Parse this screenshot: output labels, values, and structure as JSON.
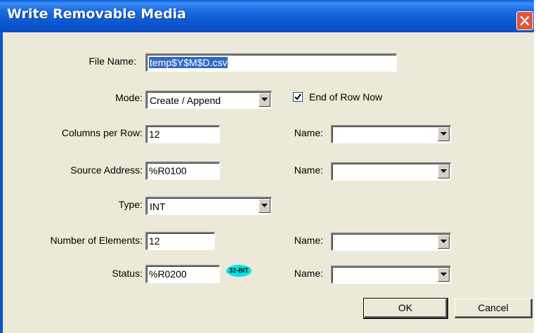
{
  "window": {
    "title": "Write Removable Media"
  },
  "file_name": {
    "label": "File Name:",
    "value": "temp$Y$M$D.csv"
  },
  "mode": {
    "label": "Mode:",
    "value": "Create / Append"
  },
  "end_of_row": {
    "label": "End of Row Now",
    "checked": true
  },
  "columns_per_row": {
    "label": "Columns per Row:",
    "value": "12",
    "name_label": "Name:",
    "name_value": ""
  },
  "source_address": {
    "label": "Source Address:",
    "value": "%R0100",
    "name_label": "Name:",
    "name_value": ""
  },
  "type": {
    "label": "Type:",
    "value": "INT"
  },
  "number_of_elements": {
    "label": "Number of Elements:",
    "value": "12",
    "name_label": "Name:",
    "name_value": ""
  },
  "status": {
    "label": "Status:",
    "value": "%R0200",
    "badge": "32-BIT",
    "name_label": "Name:",
    "name_value": ""
  },
  "buttons": {
    "ok": "OK",
    "cancel": "Cancel"
  }
}
